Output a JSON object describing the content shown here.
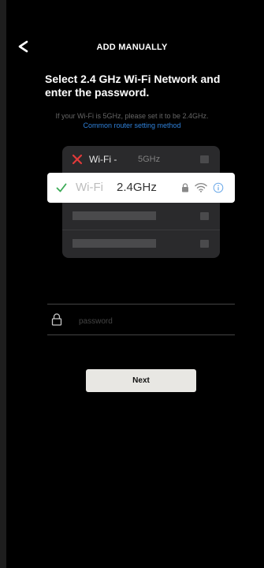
{
  "header": {
    "title": "ADD MANUALLY",
    "back_icon": "chevron-left-icon"
  },
  "content": {
    "heading": "Select 2.4 GHz Wi-Fi Network and enter the password.",
    "hint": "If your Wi-Fi is 5GHz, please set it to be 2.4GHz.",
    "router_link": "Common router setting method"
  },
  "illustration": {
    "network_5g": {
      "name": "Wi-Fi -",
      "band": "5GHz",
      "status_icon": "x-icon"
    },
    "network_24g": {
      "name": "Wi-Fi",
      "band": "2.4GHz",
      "status_icon": "check-icon"
    }
  },
  "form": {
    "password_placeholder": "password",
    "password_value": "",
    "next_label": "Next"
  },
  "colors": {
    "background": "#000000",
    "link": "#2f80d8",
    "error_red": "#e03a3a",
    "success_green": "#3aaa55",
    "button_bg": "#e8e7e3"
  }
}
